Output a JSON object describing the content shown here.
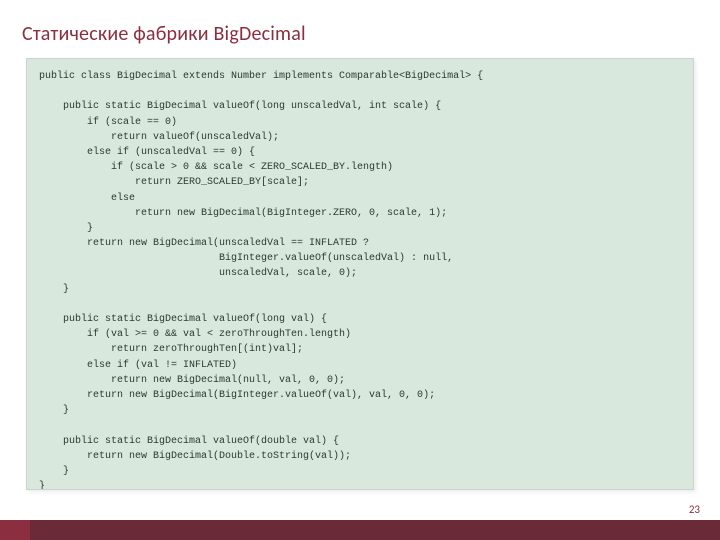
{
  "title": "Статические фабрики BigDecimal",
  "page_number": "23",
  "code": "public class BigDecimal extends Number implements Comparable<BigDecimal> {\n\n    public static BigDecimal valueOf(long unscaledVal, int scale) {\n        if (scale == 0)\n            return valueOf(unscaledVal);\n        else if (unscaledVal == 0) {\n            if (scale > 0 && scale < ZERO_SCALED_BY.length)\n                return ZERO_SCALED_BY[scale];\n            else\n                return new BigDecimal(BigInteger.ZERO, 0, scale, 1);\n        }\n        return new BigDecimal(unscaledVal == INFLATED ?\n                              BigInteger.valueOf(unscaledVal) : null,\n                              unscaledVal, scale, 0);\n    }\n\n    public static BigDecimal valueOf(long val) {\n        if (val >= 0 && val < zeroThroughTen.length)\n            return zeroThroughTen[(int)val];\n        else if (val != INFLATED)\n            return new BigDecimal(null, val, 0, 0);\n        return new BigDecimal(BigInteger.valueOf(val), val, 0, 0);\n    }\n\n    public static BigDecimal valueOf(double val) {\n        return new BigDecimal(Double.toString(val));\n    }\n}"
}
